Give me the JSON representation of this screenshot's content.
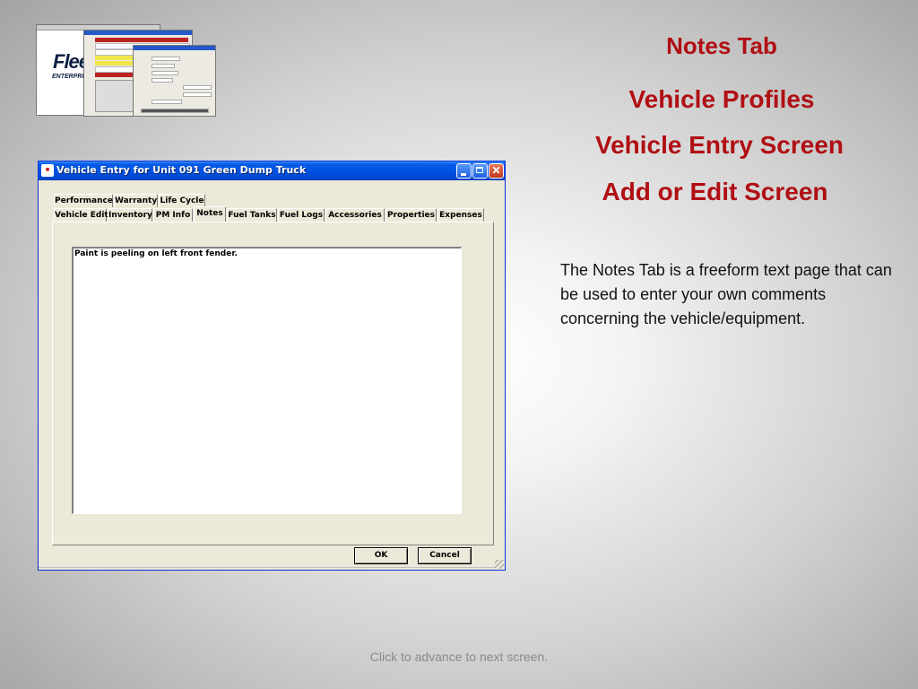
{
  "slide": {
    "title_lines": [
      "Notes Tab",
      "Vehicle Profiles",
      "Vehicle Entry Screen",
      "Add or Edit Screen"
    ],
    "description": "The Notes Tab is a  freeform text page that can be used to enter your own comments concerning the vehicle/equipment.",
    "footer": "Click to advance to next screen.",
    "title_color": "#b00f14"
  },
  "thumbnail": {
    "logo_text": "Flee",
    "logo_sub": "ENTERPRIS"
  },
  "dialog": {
    "title": "Vehicle Entry for Unit 091 Green Dump Truck",
    "app_icon": "app-icon",
    "tabs_row1": [
      "Performance",
      "Warranty",
      "Life Cycle"
    ],
    "tabs_row2": [
      "Vehicle Edit",
      "Inventory",
      "PM Info",
      "Notes",
      "Fuel Tanks",
      "Fuel Logs",
      "Accessories",
      "Properties",
      "Expenses"
    ],
    "active_tab": "Notes",
    "notes_value": "Paint is peeling on left front fender.",
    "ok_label": "OK",
    "cancel_label": "Cancel",
    "titlebar_color": "#0054e3"
  }
}
